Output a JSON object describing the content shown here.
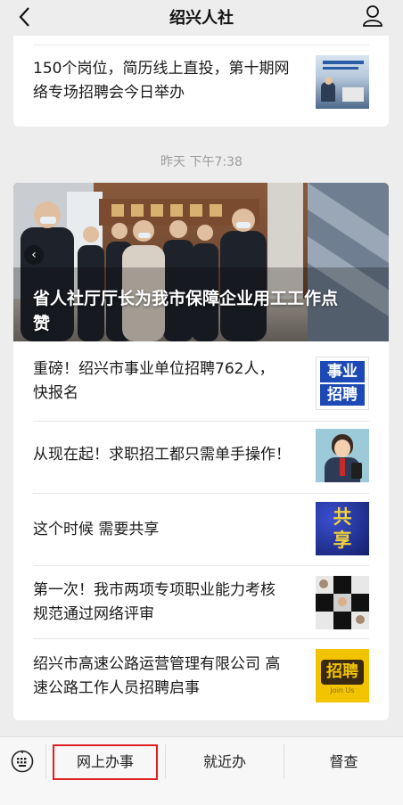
{
  "header": {
    "title": "绍兴人社",
    "back_icon": "chevron-left-icon",
    "user_icon": "user-icon"
  },
  "articles_top": [
    {
      "title": "150个岗位，简历线上直投，第十期网络专场招聘会今日举办",
      "line1": "150个岗位，简历线上直投，第十期网",
      "line2": "络专场招聘会今日举办"
    }
  ],
  "timestamp": "昨天 下午7:38",
  "hero": {
    "title_line1": "省人社厅厅长为我市保障企业用工工作点",
    "title_line2": "赞"
  },
  "articles": [
    {
      "line1": "重磅！绍兴市事业单位招聘762人，",
      "line2": "快报名",
      "thumb_text": "事业招聘"
    },
    {
      "line1": "从现在起！求职招工都只需单手操作！",
      "line2": "",
      "thumb_text": ""
    },
    {
      "line1": "这个时候 需要共享",
      "line2": "",
      "thumb_text": "共享"
    },
    {
      "line1": "第一次！我市两项专项职业能力考核",
      "line2": "规范通过网络评审",
      "thumb_text": ""
    },
    {
      "line1": "绍兴市高速公路运营管理有限公司 高",
      "line2": "速公路工作人员招聘启事",
      "thumb_text": "招聘",
      "thumb_sub": "Join Us"
    }
  ],
  "menu": {
    "keyboard_icon": "keyboard-icon",
    "items": [
      "网上办事",
      "就近办",
      "督查"
    ]
  },
  "colors": {
    "highlight": "#e02020",
    "blue_badge": "#1a3fa8"
  }
}
